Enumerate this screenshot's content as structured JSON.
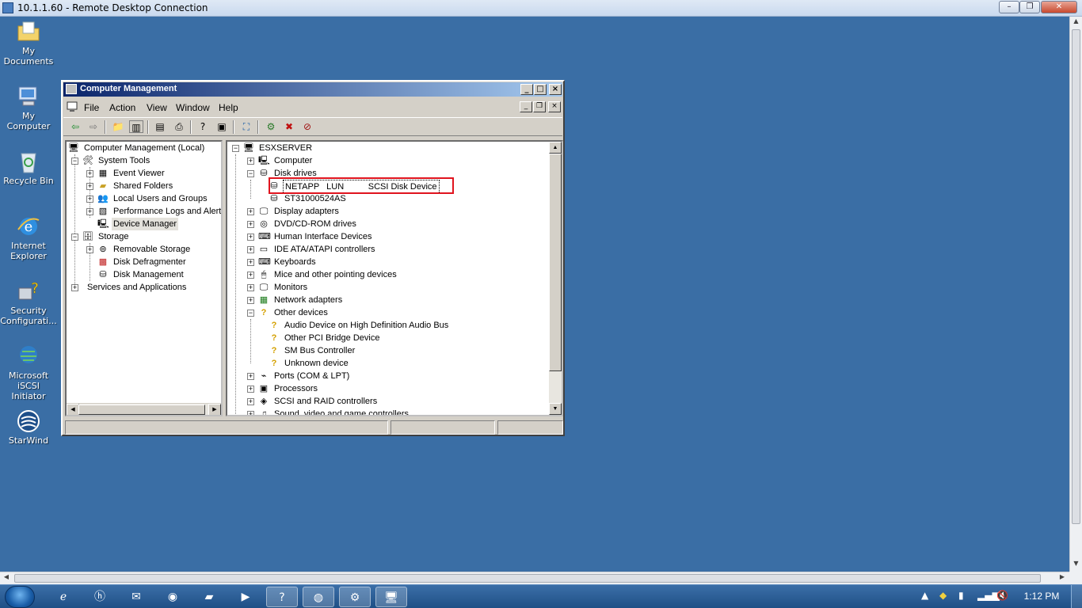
{
  "rdp": {
    "title": "10.1.1.60 - Remote Desktop Connection",
    "minimize": "–",
    "maximize": "❐",
    "close": "✕"
  },
  "desktop_icons": [
    {
      "label": "My Documents",
      "icon": "folder-documents-icon"
    },
    {
      "label": "My Computer",
      "icon": "computer-icon"
    },
    {
      "label": "Recycle Bin",
      "icon": "recycle-bin-icon"
    },
    {
      "label": "Internet Explorer",
      "icon": "internet-explorer-icon"
    },
    {
      "label": "Security Configurati...",
      "icon": "security-config-icon"
    },
    {
      "label": "Microsoft iSCSI Initiator",
      "icon": "iscsi-initiator-icon"
    },
    {
      "label": "StarWind",
      "icon": "starwind-icon"
    }
  ],
  "cm": {
    "title": "Computer Management",
    "menu": [
      "File",
      "Action",
      "View",
      "Window",
      "Help"
    ],
    "left_tree": {
      "root": "Computer Management (Local)",
      "system_tools": "System Tools",
      "event_viewer": "Event Viewer",
      "shared_folders": "Shared Folders",
      "local_users": "Local Users and Groups",
      "perf_logs": "Performance Logs and Alerts",
      "device_manager": "Device Manager",
      "storage": "Storage",
      "removable_storage": "Removable Storage",
      "disk_defrag": "Disk Defragmenter",
      "disk_management": "Disk Management",
      "services_apps": "Services and Applications"
    },
    "right_tree": {
      "root": "ESXSERVER",
      "computer": "Computer",
      "disk_drives": "Disk drives",
      "netapp": "NETAPP   LUN          SCSI Disk Device",
      "st": "ST31000524AS",
      "display": "Display adapters",
      "dvd": "DVD/CD-ROM drives",
      "hid": "Human Interface Devices",
      "ide": "IDE ATA/ATAPI controllers",
      "keyboards": "Keyboards",
      "mice": "Mice and other pointing devices",
      "monitors": "Monitors",
      "network": "Network adapters",
      "other": "Other devices",
      "audio": "Audio Device on High Definition Audio Bus",
      "pci": "Other PCI Bridge Device",
      "smbus": "SM Bus Controller",
      "unknown": "Unknown device",
      "ports": "Ports (COM & LPT)",
      "processors": "Processors",
      "scsi": "SCSI and RAID controllers",
      "sound": "Sound, video and game controllers"
    }
  },
  "taskbar": {
    "clock": "1:12 PM"
  }
}
